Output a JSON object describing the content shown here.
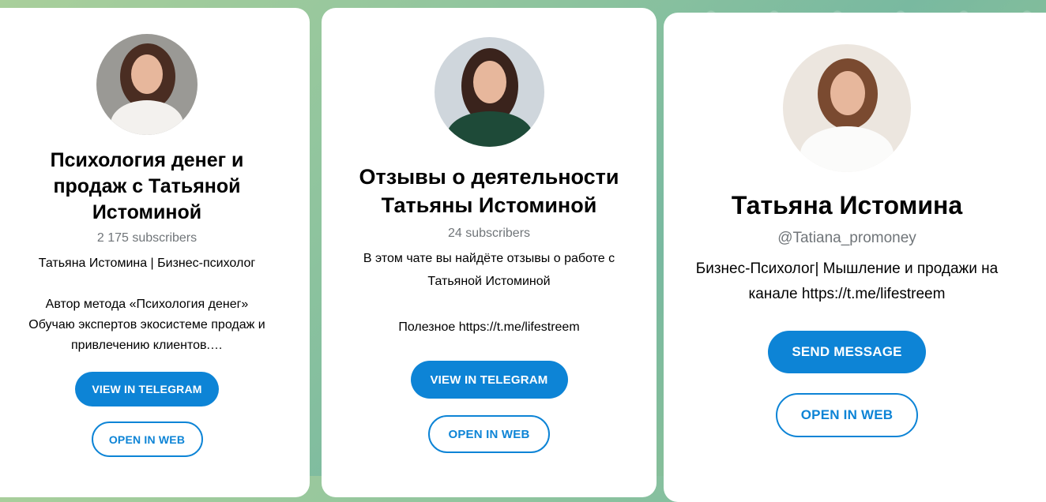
{
  "cards": [
    {
      "title": "Психология денег и продаж с Татьяной Истоминой",
      "subscribers": "2 175 subscribers",
      "description": "Татьяна Истомина | Бизнес-психолог\n\nАвтор метода «Психология денег»\nОбучаю экспертов экосистеме продаж и привлечению клиентов.…",
      "primary_button": "VIEW IN TELEGRAM",
      "secondary_button": "OPEN IN WEB"
    },
    {
      "title": "Отзывы о деятельности Татьяны Истоминой",
      "subscribers": "24 subscribers",
      "description": "В этом чате вы найдёте отзывы о работе с Татьяной Истоминой\n\nПолезное https://t.me/lifestreem",
      "primary_button": "VIEW IN TELEGRAM",
      "secondary_button": "OPEN IN WEB"
    },
    {
      "title": "Татьяна Истомина",
      "username": "@Tatiana_promoney",
      "description": "Бизнес-Психолог| Мышление и продажи на канале https://t.me/lifestreem",
      "primary_button": "SEND MESSAGE",
      "secondary_button": "OPEN IN WEB"
    }
  ],
  "colors": {
    "accent": "#0d84d6",
    "muted_text": "#707579"
  }
}
